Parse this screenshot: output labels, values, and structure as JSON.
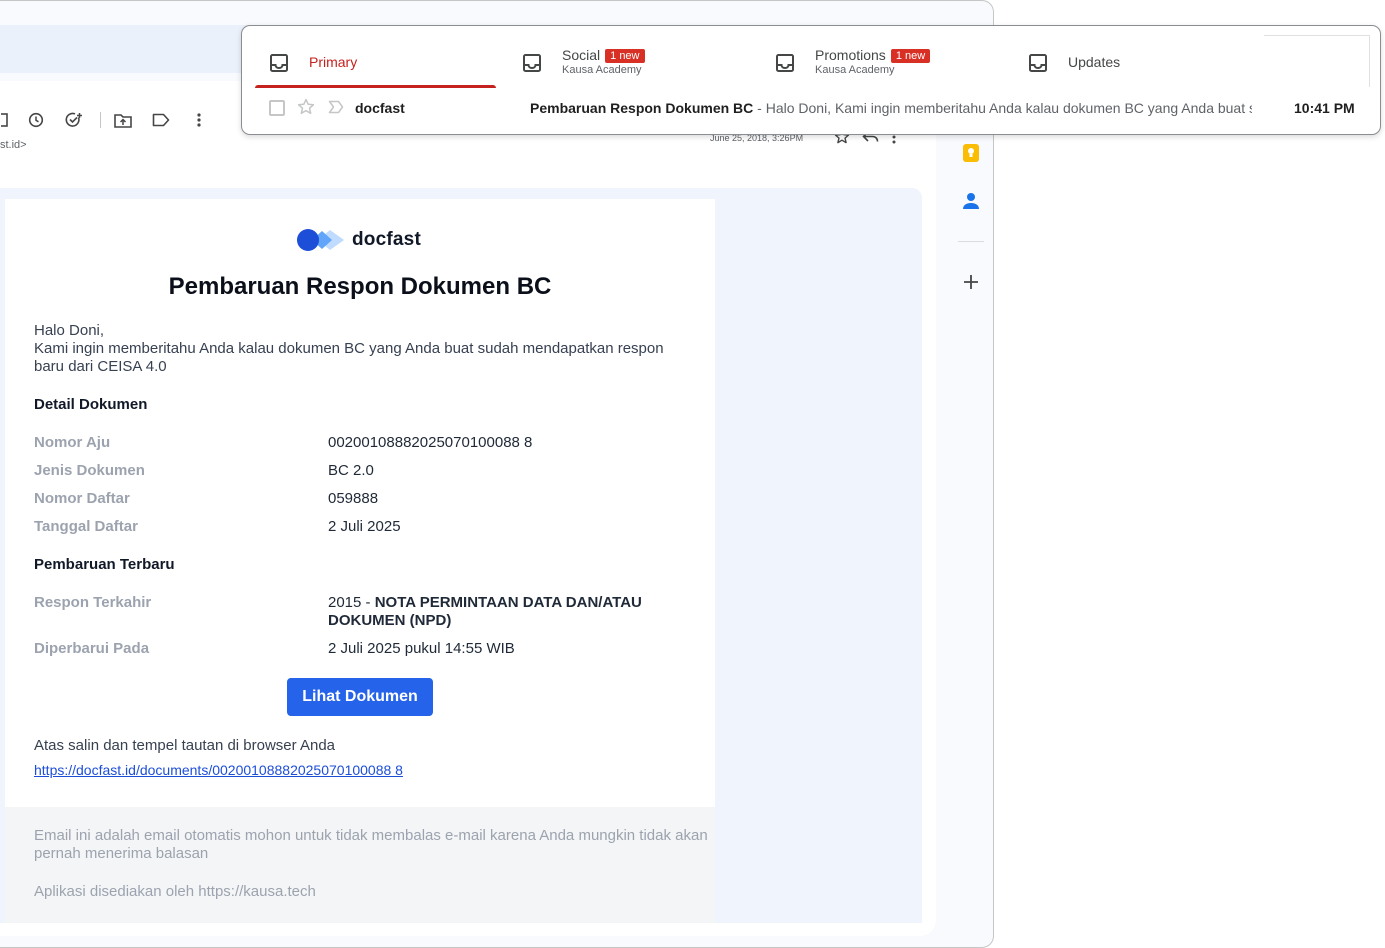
{
  "gmail": {
    "sender_email_fragment": "st.id>",
    "message_date": "June 25, 2018, 3:26PM"
  },
  "email": {
    "brand_name": "docfast",
    "title": "Pembaruan Respon Dokumen BC",
    "greeting": "Halo Doni,",
    "intro": "Kami ingin memberitahu Anda kalau dokumen BC yang Anda buat sudah mendapatkan respon baru dari CEISA 4.0",
    "detail_heading": "Detail Dokumen",
    "details": [
      {
        "label": "Nomor Aju",
        "value": "00200108882025070100088 8"
      },
      {
        "label": "Jenis Dokumen",
        "value": "BC 2.0"
      },
      {
        "label": "Nomor Daftar",
        "value": "059888"
      },
      {
        "label": "Tanggal Daftar",
        "value": "2 Juli 2025"
      }
    ],
    "update_heading": "Pembaruan Terbaru",
    "latest_response_label": "Respon Terkahir",
    "latest_response_code": "2015 - ",
    "latest_response_text": "NOTA PERMINTAAN DATA DAN/ATAU DOKUMEN (NPD)",
    "updated_at_label": "Diperbarui Pada",
    "updated_at_value": "2 Juli 2025 pukul 14:55 WIB",
    "button_label": "Lihat Dokumen",
    "copy_hint": "Atas salin dan tempel tautan di browser Anda",
    "document_link": "https://docfast.id/documents/00200108882025070100088 8",
    "footer_notice": "Email ini adalah email otomatis  mohon untuk tidak membalas e-mail karena Anda mungkin tidak akan pernah menerima balasan",
    "footer_provider": "Aplikasi disediakan oleh https://kausa.tech"
  },
  "notification": {
    "tabs": [
      {
        "label": "Primary",
        "sub": "",
        "badge": ""
      },
      {
        "label": "Social",
        "sub": "Kausa Academy",
        "badge": "1 new"
      },
      {
        "label": "Promotions",
        "sub": "Kausa Academy",
        "badge": "1 new"
      },
      {
        "label": "Updates",
        "sub": "",
        "badge": ""
      }
    ],
    "row": {
      "sender": "docfast",
      "subject": "Pembaruan Respon Dokumen BC",
      "snippet": " - Halo Doni, Kami ingin memberitahu Anda kalau dokumen BC yang Anda buat sudah mendapatkan respon baru",
      "time": "10:41 PM"
    }
  },
  "colors": {
    "accent_red": "#c5221f",
    "button_blue": "#2563eb",
    "link_blue": "#1d4ed8"
  }
}
